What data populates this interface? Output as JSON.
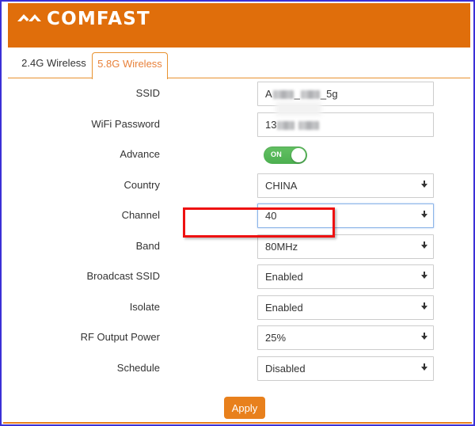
{
  "brand": {
    "name": "COMFAST",
    "logo_icon": "comfast-chevron-mark",
    "header_color": "#e06e0b"
  },
  "tabs": [
    {
      "label": "2.4G Wireless",
      "active": false
    },
    {
      "label": "5.8G Wireless",
      "active": true
    }
  ],
  "form": {
    "rows": [
      {
        "label": "SSID",
        "type": "text",
        "value_prefix": "A",
        "value_suffix": "_5g",
        "redacted": true,
        "name": "ssid"
      },
      {
        "label": "WiFi Password",
        "type": "text",
        "value_prefix": "13",
        "value_suffix": "",
        "redacted": true,
        "name": "wifi-password"
      },
      {
        "label": "Advance",
        "type": "toggle",
        "value": "ON",
        "name": "advance"
      },
      {
        "label": "Country",
        "type": "select",
        "value": "CHINA",
        "name": "country"
      },
      {
        "label": "Channel",
        "type": "select",
        "value": "40",
        "focused": true,
        "highlighted": true,
        "name": "channel"
      },
      {
        "label": "Band",
        "type": "select",
        "value": "80MHz",
        "name": "band"
      },
      {
        "label": "Broadcast SSID",
        "type": "select",
        "value": "Enabled",
        "name": "broadcast-ssid"
      },
      {
        "label": "Isolate",
        "type": "select",
        "value": "Enabled",
        "name": "isolate"
      },
      {
        "label": "RF Output Power",
        "type": "select",
        "value": "25%",
        "name": "rf-output-power"
      },
      {
        "label": "Schedule",
        "type": "select",
        "value": "Disabled",
        "name": "schedule"
      }
    ]
  },
  "actions": {
    "apply_label": "Apply",
    "apply_color": "#e8801c"
  },
  "annotation": {
    "type": "red-rectangle",
    "color": "#ee1111",
    "targets": "channel-row"
  }
}
